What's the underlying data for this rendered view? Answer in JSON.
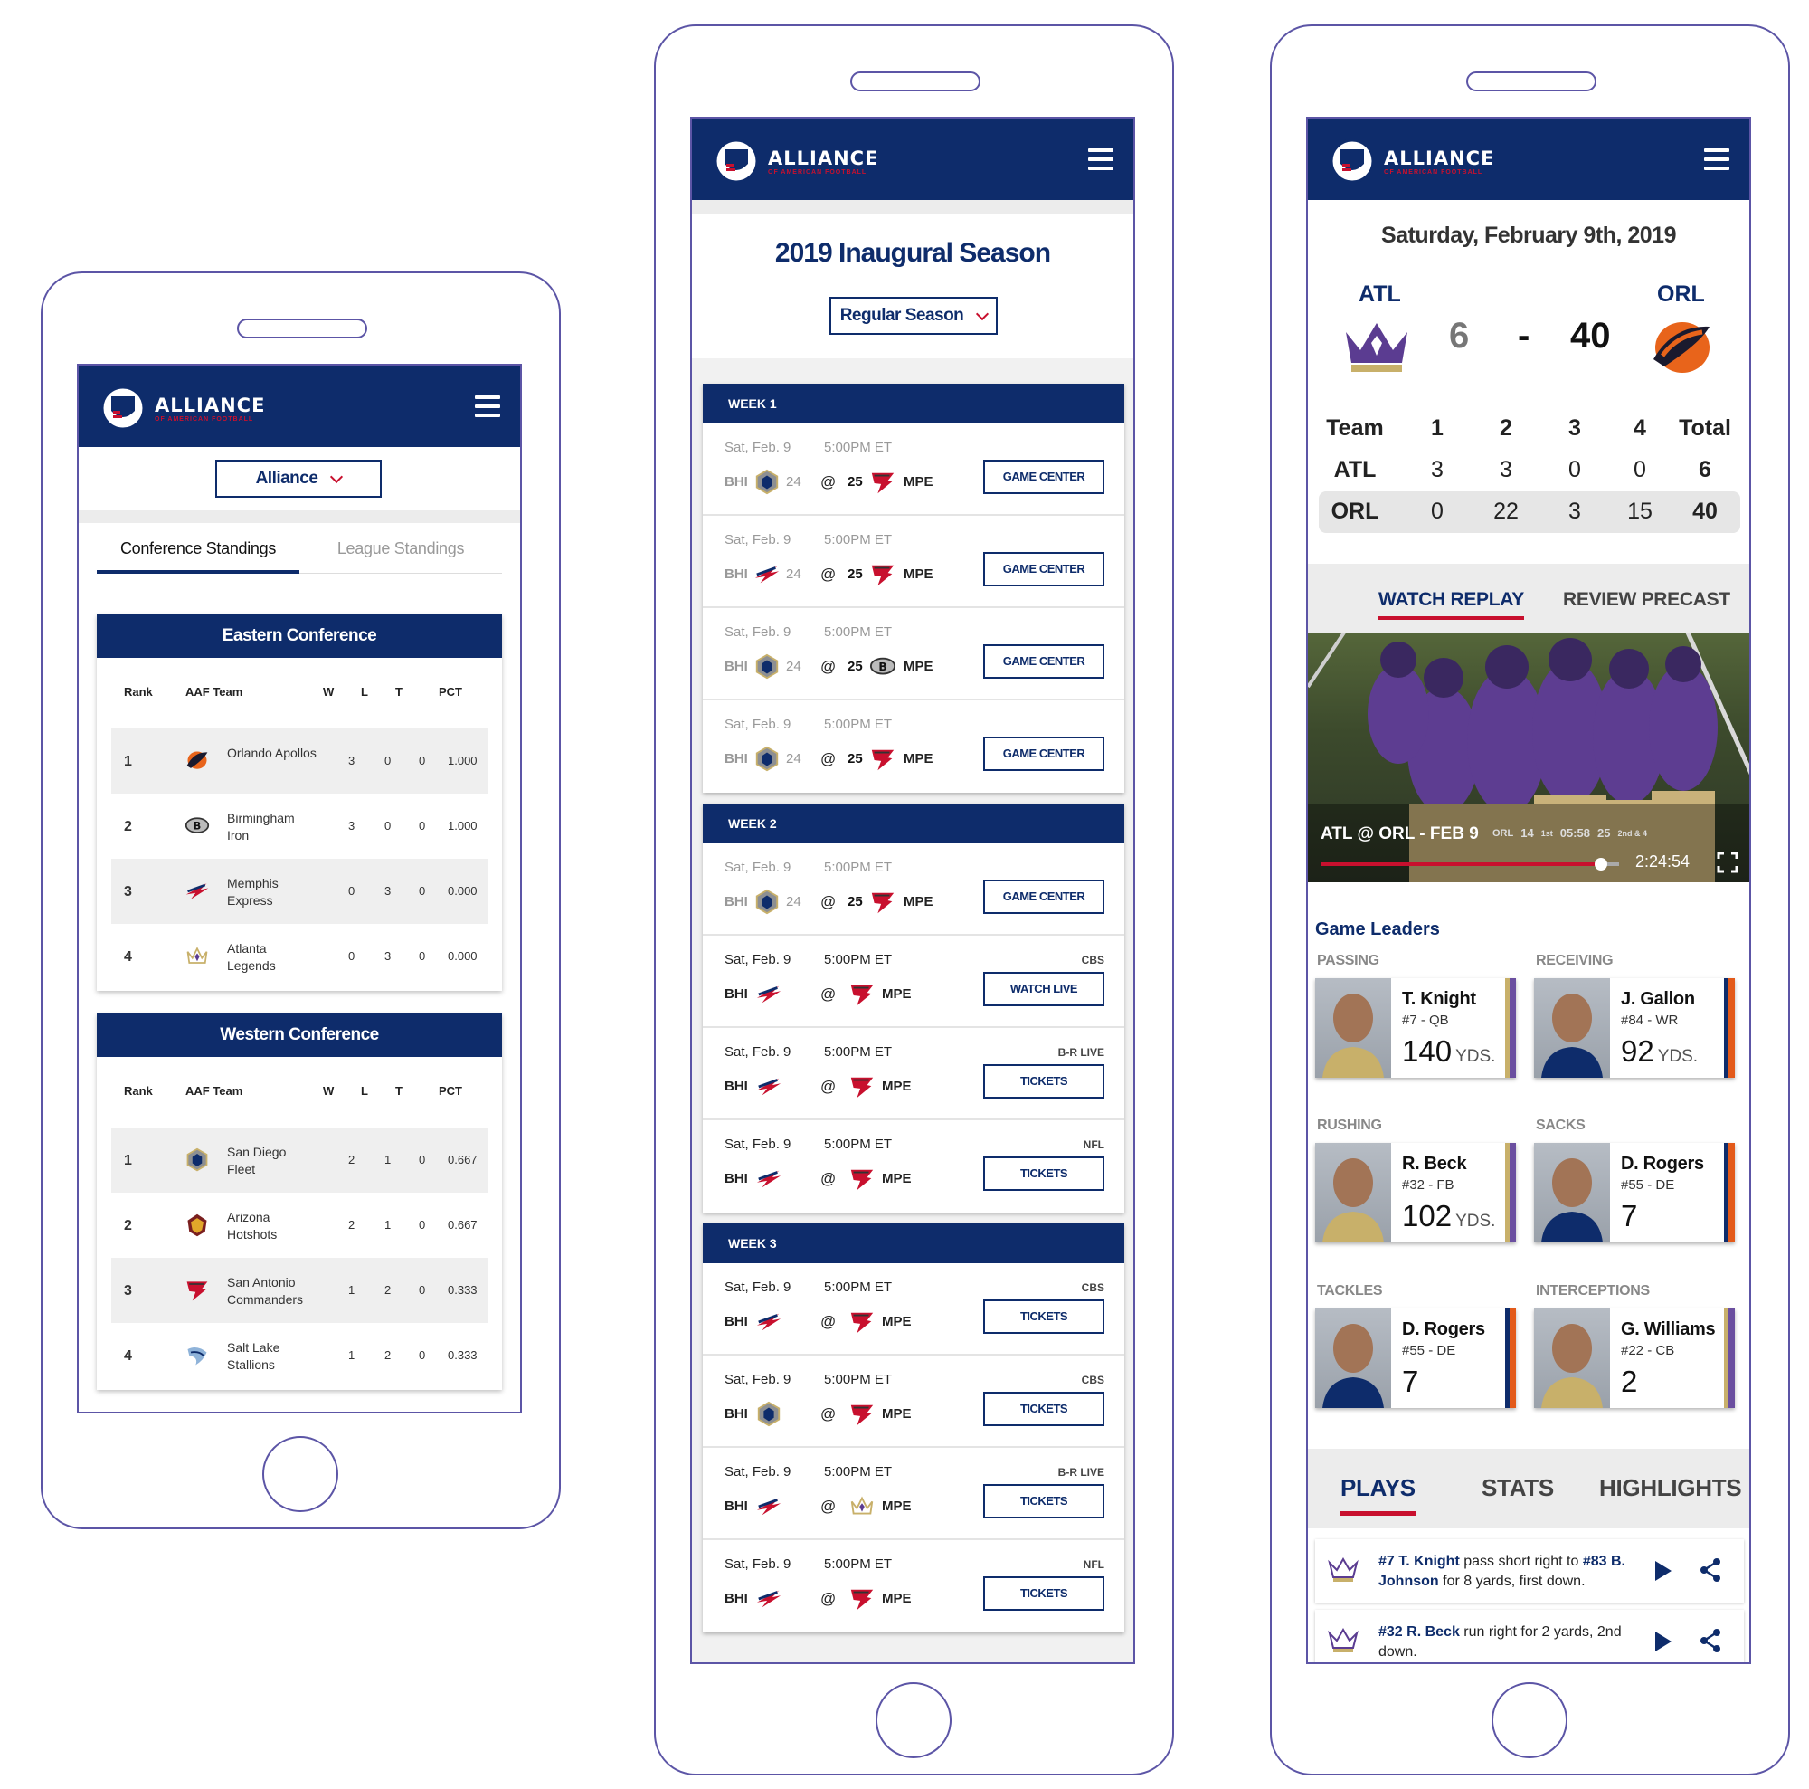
{
  "brand": {
    "name": "ALLIANCE",
    "subtitle": "OF AMERICAN FOOTBALL"
  },
  "colors": {
    "navy": "#0e2c6b",
    "red": "#c8102e",
    "gray": "#ececec",
    "frame": "#5c55a6"
  },
  "standings": {
    "dropdown": "Alliance",
    "tabs": [
      "Conference Standings",
      "League Standings"
    ],
    "columns": [
      "Rank",
      "AAF Team",
      "W",
      "L",
      "T",
      "PCT"
    ],
    "eastern": {
      "title": "Eastern Conference",
      "rows": [
        {
          "rank": "1",
          "team": "Orlando Apollos",
          "w": "3",
          "l": "0",
          "t": "0",
          "pct": "1.000",
          "logo": "apollos-logo"
        },
        {
          "rank": "2",
          "team": "Birmingham Iron",
          "w": "3",
          "l": "0",
          "t": "0",
          "pct": "1.000",
          "logo": "iron-logo"
        },
        {
          "rank": "3",
          "team": "Memphis Express",
          "w": "0",
          "l": "3",
          "t": "0",
          "pct": "0.000",
          "logo": "express-logo"
        },
        {
          "rank": "4",
          "team": "Atlanta Legends",
          "w": "0",
          "l": "3",
          "t": "0",
          "pct": "0.000",
          "logo": "legends-logo"
        }
      ]
    },
    "western": {
      "title": "Western Conference",
      "rows": [
        {
          "rank": "1",
          "team": "San Diego Fleet",
          "w": "2",
          "l": "1",
          "t": "0",
          "pct": "0.667",
          "logo": "fleet-logo"
        },
        {
          "rank": "2",
          "team": "Arizona Hotshots",
          "w": "2",
          "l": "1",
          "t": "0",
          "pct": "0.667",
          "logo": "hotshots-logo"
        },
        {
          "rank": "3",
          "team": "San Antonio Commanders",
          "w": "1",
          "l": "2",
          "t": "0",
          "pct": "0.333",
          "logo": "commanders-logo"
        },
        {
          "rank": "4",
          "team": "Salt Lake Stallions",
          "w": "1",
          "l": "2",
          "t": "0",
          "pct": "0.333",
          "logo": "stallions-logo"
        }
      ]
    }
  },
  "schedule": {
    "title": "2019 Inaugural Season",
    "dropdown": "Regular Season",
    "weeks": [
      {
        "title": "WEEK 1",
        "games": [
          {
            "date": "Sat, Feb. 9",
            "time": "5:00PM ET",
            "network": "",
            "home": "BHI",
            "home_score": "24",
            "at": "@",
            "away_score": "25",
            "away": "MPE",
            "button": "GAME CENTER",
            "muted": true,
            "hlogo": "fleet",
            "alogo": "commanders"
          },
          {
            "date": "Sat, Feb. 9",
            "time": "5:00PM ET",
            "network": "",
            "home": "BHI",
            "home_score": "24",
            "at": "@",
            "away_score": "25",
            "away": "MPE",
            "button": "GAME CENTER",
            "muted": true,
            "hlogo": "express",
            "alogo": "commanders"
          },
          {
            "date": "Sat, Feb. 9",
            "time": "5:00PM ET",
            "network": "",
            "home": "BHI",
            "home_score": "24",
            "at": "@",
            "away_score": "25",
            "away": "MPE",
            "button": "GAME CENTER",
            "muted": true,
            "hlogo": "fleet",
            "alogo": "iron"
          },
          {
            "date": "Sat, Feb. 9",
            "time": "5:00PM ET",
            "network": "",
            "home": "BHI",
            "home_score": "24",
            "at": "@",
            "away_score": "25",
            "away": "MPE",
            "button": "GAME CENTER",
            "muted": true,
            "hlogo": "fleet",
            "alogo": "commanders"
          }
        ]
      },
      {
        "title": "WEEK 2",
        "games": [
          {
            "date": "Sat, Feb. 9",
            "time": "5:00PM ET",
            "network": "",
            "home": "BHI",
            "home_score": "24",
            "at": "@",
            "away_score": "25",
            "away": "MPE",
            "button": "GAME CENTER",
            "muted": true,
            "hlogo": "fleet",
            "alogo": "commanders"
          },
          {
            "date": "Sat, Feb. 9",
            "time": "5:00PM ET",
            "network": "CBS",
            "home": "BHI",
            "home_score": "",
            "at": "@",
            "away_score": "",
            "away": "MPE",
            "button": "WATCH LIVE",
            "muted": false,
            "hlogo": "express",
            "alogo": "commanders"
          },
          {
            "date": "Sat, Feb. 9",
            "time": "5:00PM ET",
            "network": "B-R LIVE",
            "home": "BHI",
            "home_score": "",
            "at": "@",
            "away_score": "",
            "away": "MPE",
            "button": "TICKETS",
            "muted": false,
            "hlogo": "express",
            "alogo": "commanders"
          },
          {
            "date": "Sat, Feb. 9",
            "time": "5:00PM ET",
            "network": "NFL",
            "home": "BHI",
            "home_score": "",
            "at": "@",
            "away_score": "",
            "away": "MPE",
            "button": "TICKETS",
            "muted": false,
            "hlogo": "express",
            "alogo": "commanders"
          }
        ]
      },
      {
        "title": "WEEK 3",
        "games": [
          {
            "date": "Sat, Feb. 9",
            "time": "5:00PM ET",
            "network": "CBS",
            "home": "BHI",
            "home_score": "",
            "at": "@",
            "away_score": "",
            "away": "MPE",
            "button": "TICKETS",
            "muted": false,
            "hlogo": "express",
            "alogo": "commanders"
          },
          {
            "date": "Sat, Feb. 9",
            "time": "5:00PM ET",
            "network": "CBS",
            "home": "BHI",
            "home_score": "",
            "at": "@",
            "away_score": "",
            "away": "MPE",
            "button": "TICKETS",
            "muted": false,
            "hlogo": "fleet",
            "alogo": "commanders"
          },
          {
            "date": "Sat, Feb. 9",
            "time": "5:00PM ET",
            "network": "B-R LIVE",
            "home": "BHI",
            "home_score": "",
            "at": "@",
            "away_score": "",
            "away": "MPE",
            "button": "TICKETS",
            "muted": false,
            "hlogo": "express",
            "alogo": "legends"
          },
          {
            "date": "Sat, Feb. 9",
            "time": "5:00PM ET",
            "network": "NFL",
            "home": "BHI",
            "home_score": "",
            "at": "@",
            "away_score": "",
            "away": "MPE",
            "button": "TICKETS",
            "muted": false,
            "hlogo": "express",
            "alogo": "commanders"
          }
        ]
      }
    ]
  },
  "game": {
    "date": "Saturday, February 9th, 2019",
    "away": {
      "abbr": "ATL",
      "score": "6"
    },
    "home": {
      "abbr": "ORL",
      "score": "40"
    },
    "dash": "-",
    "linescore": {
      "header": [
        "Team",
        "1",
        "2",
        "3",
        "4",
        "Total"
      ],
      "rows": [
        [
          "ATL",
          "3",
          "3",
          "0",
          "0",
          "6"
        ],
        [
          "ORL",
          "0",
          "22",
          "3",
          "15",
          "40"
        ]
      ]
    },
    "media_tabs": [
      "WATCH REPLAY",
      "REVIEW PRECAST"
    ],
    "video": {
      "caption": "ATL @ ORL - FEB 9",
      "bug": {
        "orl": "ORL",
        "orl_score": "14",
        "quarter": "1st",
        "clock": "05:58",
        "play_clock": "25",
        "down": "2nd & 4"
      },
      "duration": "2:24:54",
      "progress": 0.94
    },
    "leaders_title": "Game Leaders",
    "leaders": [
      {
        "category": "PASSING",
        "name": "T. Knight",
        "pos": "#7 - QB",
        "value": "140",
        "unit": "YDS.",
        "stripe": "#6b4fa0",
        "accent": "#c8b06a"
      },
      {
        "category": "RECEIVING",
        "name": "J. Gallon",
        "pos": "#84 - WR",
        "value": "92",
        "unit": "YDS.",
        "stripe": "#e35a1a",
        "accent": "#0e2c6b"
      },
      {
        "category": "RUSHING",
        "name": "R. Beck",
        "pos": "#32 - FB",
        "value": "102",
        "unit": "YDS.",
        "stripe": "#6b4fa0",
        "accent": "#c8b06a"
      },
      {
        "category": "SACKS",
        "name": "D. Rogers",
        "pos": "#55 - DE",
        "value": "7",
        "unit": "",
        "stripe": "#e35a1a",
        "accent": "#0e2c6b"
      },
      {
        "category": "TACKLES",
        "name": "D. Rogers",
        "pos": "#55 - DE",
        "value": "7",
        "unit": "",
        "stripe": "#e35a1a",
        "accent": "#0e2c6b"
      },
      {
        "category": "INTERCEPTIONS",
        "name": "G. Williams",
        "pos": "#22 - CB",
        "value": "2",
        "unit": "",
        "stripe": "#6b4fa0",
        "accent": "#c8b06a"
      }
    ],
    "bottom_tabs": [
      "PLAYS",
      "STATS",
      "HIGHLIGHTS"
    ],
    "plays": [
      {
        "p1": "#7 T. Knight",
        "t1": " pass short right to ",
        "p2": "#83 B. Johnson",
        "t2": " for 8 yards, first down."
      },
      {
        "p1": "#32 R. Beck",
        "t1": " run right for 2 yards, 2nd down.",
        "p2": "",
        "t2": ""
      }
    ]
  }
}
